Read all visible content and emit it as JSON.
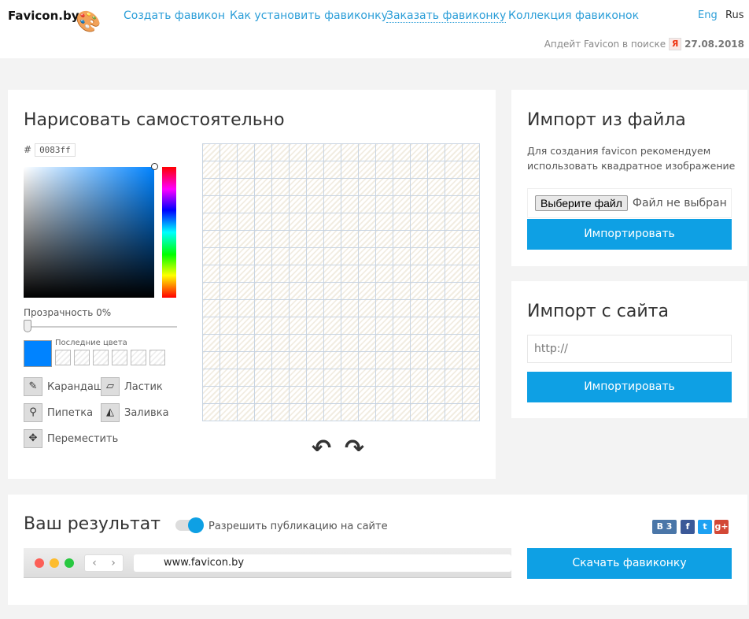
{
  "header": {
    "logo": "Favicon.by",
    "nav": [
      "Создать фавикон",
      "Как установить фавиконку",
      "Заказать фавиконку",
      "Коллекция фавиконок"
    ],
    "lang_eng": "Eng",
    "lang_rus": "Rus",
    "update_text": "Апдейт Favicon в поиске",
    "yandex": "Я",
    "update_date": "27.08.2018"
  },
  "draw": {
    "title": "Нарисовать самостоятельно",
    "hash": "#",
    "hex": "0083ff",
    "color": "#0083ff",
    "opacity_label": "Прозрачность 0%",
    "opacity": 0,
    "recent_label": "Последние цвета",
    "tools": {
      "pencil": "Карандаш",
      "eraser": "Ластик",
      "pipette": "Пипетка",
      "fill": "Заливка",
      "move": "Переместить"
    },
    "undo": "↶",
    "redo": "↷"
  },
  "import_file": {
    "title": "Импорт из файла",
    "hint": "Для создания favicon рекомендуем использовать квадратное изображение",
    "choose": "Выберите файл",
    "no_file": "Файл не выбран",
    "button": "Импортировать"
  },
  "import_site": {
    "title": "Импорт с сайта",
    "placeholder": "http://",
    "button": "Импортировать"
  },
  "result": {
    "title": "Ваш результат",
    "publish_label": "Разрешить публикацию на сайте",
    "publish": true,
    "vk": "В 3",
    "fb": "f",
    "tw": "t",
    "gp": "g+",
    "url": "www.favicon.by",
    "back": "‹",
    "forward": "›",
    "download": "Скачать фавиконку"
  }
}
